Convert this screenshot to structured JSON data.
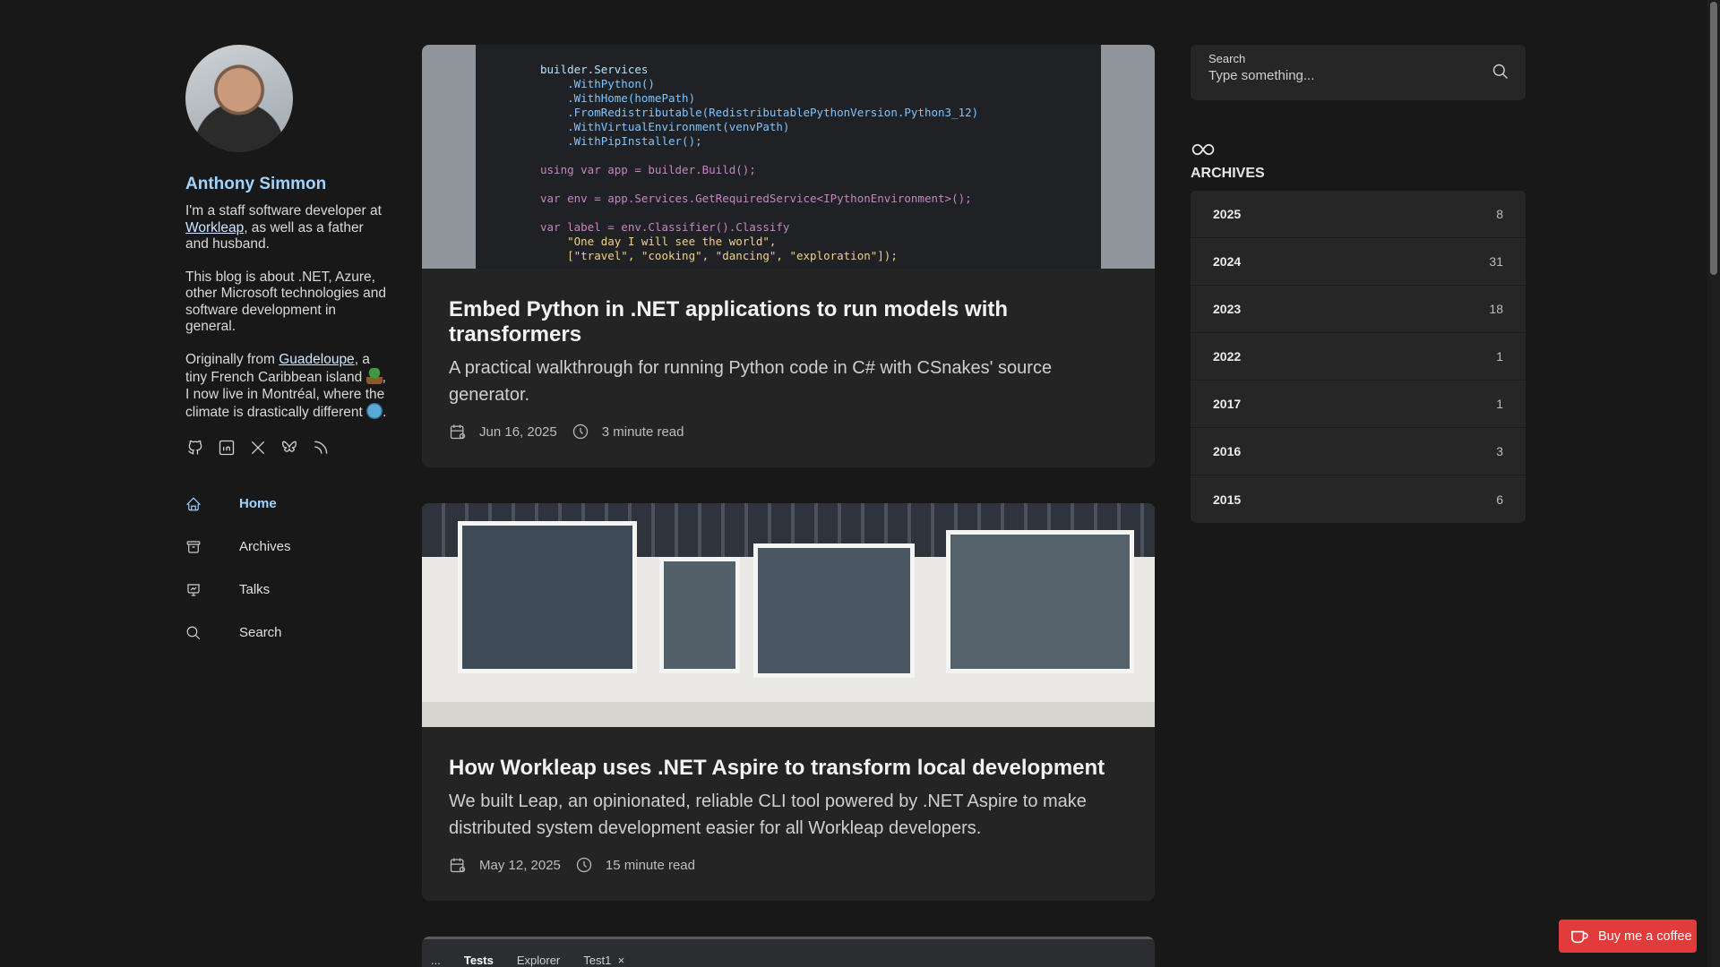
{
  "author": {
    "name": "Anthony Simmon",
    "bio1_pre": "I'm a staff software developer at ",
    "bio1_link": "Workleap",
    "bio1_post": ", as well as a father and husband.",
    "bio2": "This blog is about .NET, Azure, other Microsoft technologies and software development in general.",
    "bio3_pre": "Originally from ",
    "bio3_link": "Guadeloupe",
    "bio3_mid": ", a tiny French Caribbean island ",
    "bio3_mid2": ", I now live in Montréal, where the climate is drastically different ",
    "bio3_post": "."
  },
  "socials": [
    {
      "icon": "github-icon"
    },
    {
      "icon": "linkedin-icon"
    },
    {
      "icon": "x-twitter-icon"
    },
    {
      "icon": "bluesky-icon"
    },
    {
      "icon": "rss-icon"
    }
  ],
  "nav": [
    {
      "label": "Home",
      "icon": "home-icon",
      "active": true
    },
    {
      "label": "Archives",
      "icon": "archive-icon",
      "active": false
    },
    {
      "label": "Talks",
      "icon": "presentation-icon",
      "active": false
    },
    {
      "label": "Search",
      "icon": "search-icon",
      "active": false
    }
  ],
  "posts": [
    {
      "title": "Embed Python in .NET applications to run models with transformers",
      "description": "A practical walkthrough for running Python code in C# with CSnakes' source generator.",
      "date": "Jun 16, 2025",
      "read_time": "3 minute read"
    },
    {
      "title": "How Workleap uses .NET Aspire to transform local development",
      "description": "We built Leap, an opinionated, reliable CLI tool powered by .NET Aspire to make distributed system development easier for all Workleap developers.",
      "date": "May 12, 2025",
      "read_time": "15 minute read"
    }
  ],
  "code_snippet": {
    "lines": [
      "builder.Services",
      "    .WithPython()",
      "    .WithHome(homePath)",
      "    .FromRedistributable(RedistributablePythonVersion.Python3_12)",
      "    .WithVirtualEnvironment(venvPath)",
      "    .WithPipInstaller();",
      "",
      "using var app = builder.Build();",
      "",
      "var env = app.Services.GetRequiredService<IPythonEnvironment>();",
      "",
      "var label = env.Classifier().Classify",
      "    \"One day I will see the world\",",
      "    [\"travel\", \"cooking\", \"dancing\", \"exploration\"]);"
    ]
  },
  "peek_tabs": {
    "more": "...",
    "tab1": "Tests",
    "tab2": "Explorer",
    "tab3": "Test1",
    "close": "×"
  },
  "search": {
    "label": "Search",
    "placeholder": "Type something..."
  },
  "archives": {
    "title": "ARCHIVES",
    "items": [
      {
        "year": "2025",
        "count": "8"
      },
      {
        "year": "2024",
        "count": "31"
      },
      {
        "year": "2023",
        "count": "18"
      },
      {
        "year": "2022",
        "count": "1"
      },
      {
        "year": "2017",
        "count": "1"
      },
      {
        "year": "2016",
        "count": "3"
      },
      {
        "year": "2015",
        "count": "6"
      }
    ]
  },
  "coffee": {
    "label": "Buy me a coffee"
  },
  "colors": {
    "accent": "#9fd4ff",
    "background": "#181818",
    "card": "#242424",
    "coffee": "#e23b3b"
  }
}
